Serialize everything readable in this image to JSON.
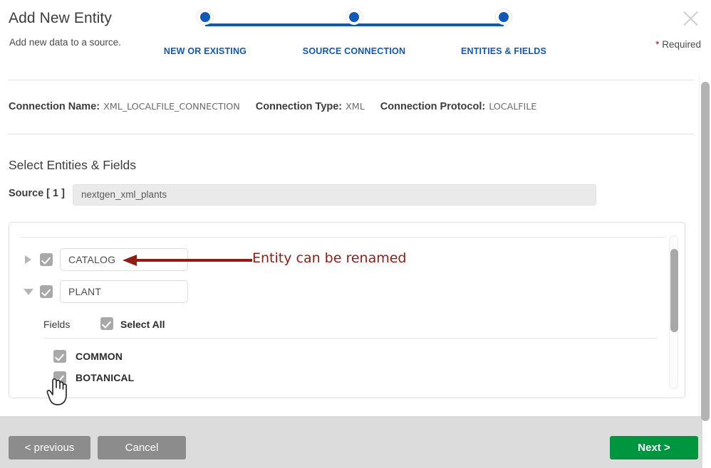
{
  "header": {
    "title": "Add New Entity",
    "subtitle": "Add new data to a source.",
    "close_icon": "close-icon",
    "required_star": "*",
    "required_label": "Required"
  },
  "stepper": {
    "steps": [
      {
        "label": "NEW OR EXISTING",
        "state": "complete"
      },
      {
        "label": "SOURCE CONNECTION",
        "state": "complete"
      },
      {
        "label": "ENTITIES & FIELDS",
        "state": "current"
      }
    ],
    "accent_color": "#1059b8"
  },
  "connection": {
    "name_label": "Connection Name:",
    "name_value": "XML_LOCALFILE_CONNECTION",
    "type_label": "Connection Type:",
    "type_value": "XML",
    "protocol_label": "Connection Protocol:",
    "protocol_value": "LOCALFILE"
  },
  "section": {
    "title": "Select Entities & Fields",
    "source_label": "Source [ 1 ]",
    "source_value": "nextgen_xml_plants"
  },
  "entities": [
    {
      "name": "CATALOG",
      "checked": true,
      "expanded": false,
      "caret_icon": "caret-right-icon"
    },
    {
      "name": "PLANT",
      "checked": true,
      "expanded": true,
      "caret_icon": "caret-down-icon"
    }
  ],
  "fields_block": {
    "label": "Fields",
    "select_all_label": "Select All",
    "select_all_checked": true,
    "fields": [
      {
        "name": "COMMON",
        "checked": true
      },
      {
        "name": "BOTANICAL",
        "checked": true
      }
    ]
  },
  "annotation": {
    "text": "Entity can be renamed",
    "color": "#8f1d14"
  },
  "footer": {
    "previous_label": "< previous",
    "cancel_label": "Cancel",
    "next_label": "Next >",
    "next_color": "#009640",
    "neutral_color": "#8c8c8c"
  }
}
